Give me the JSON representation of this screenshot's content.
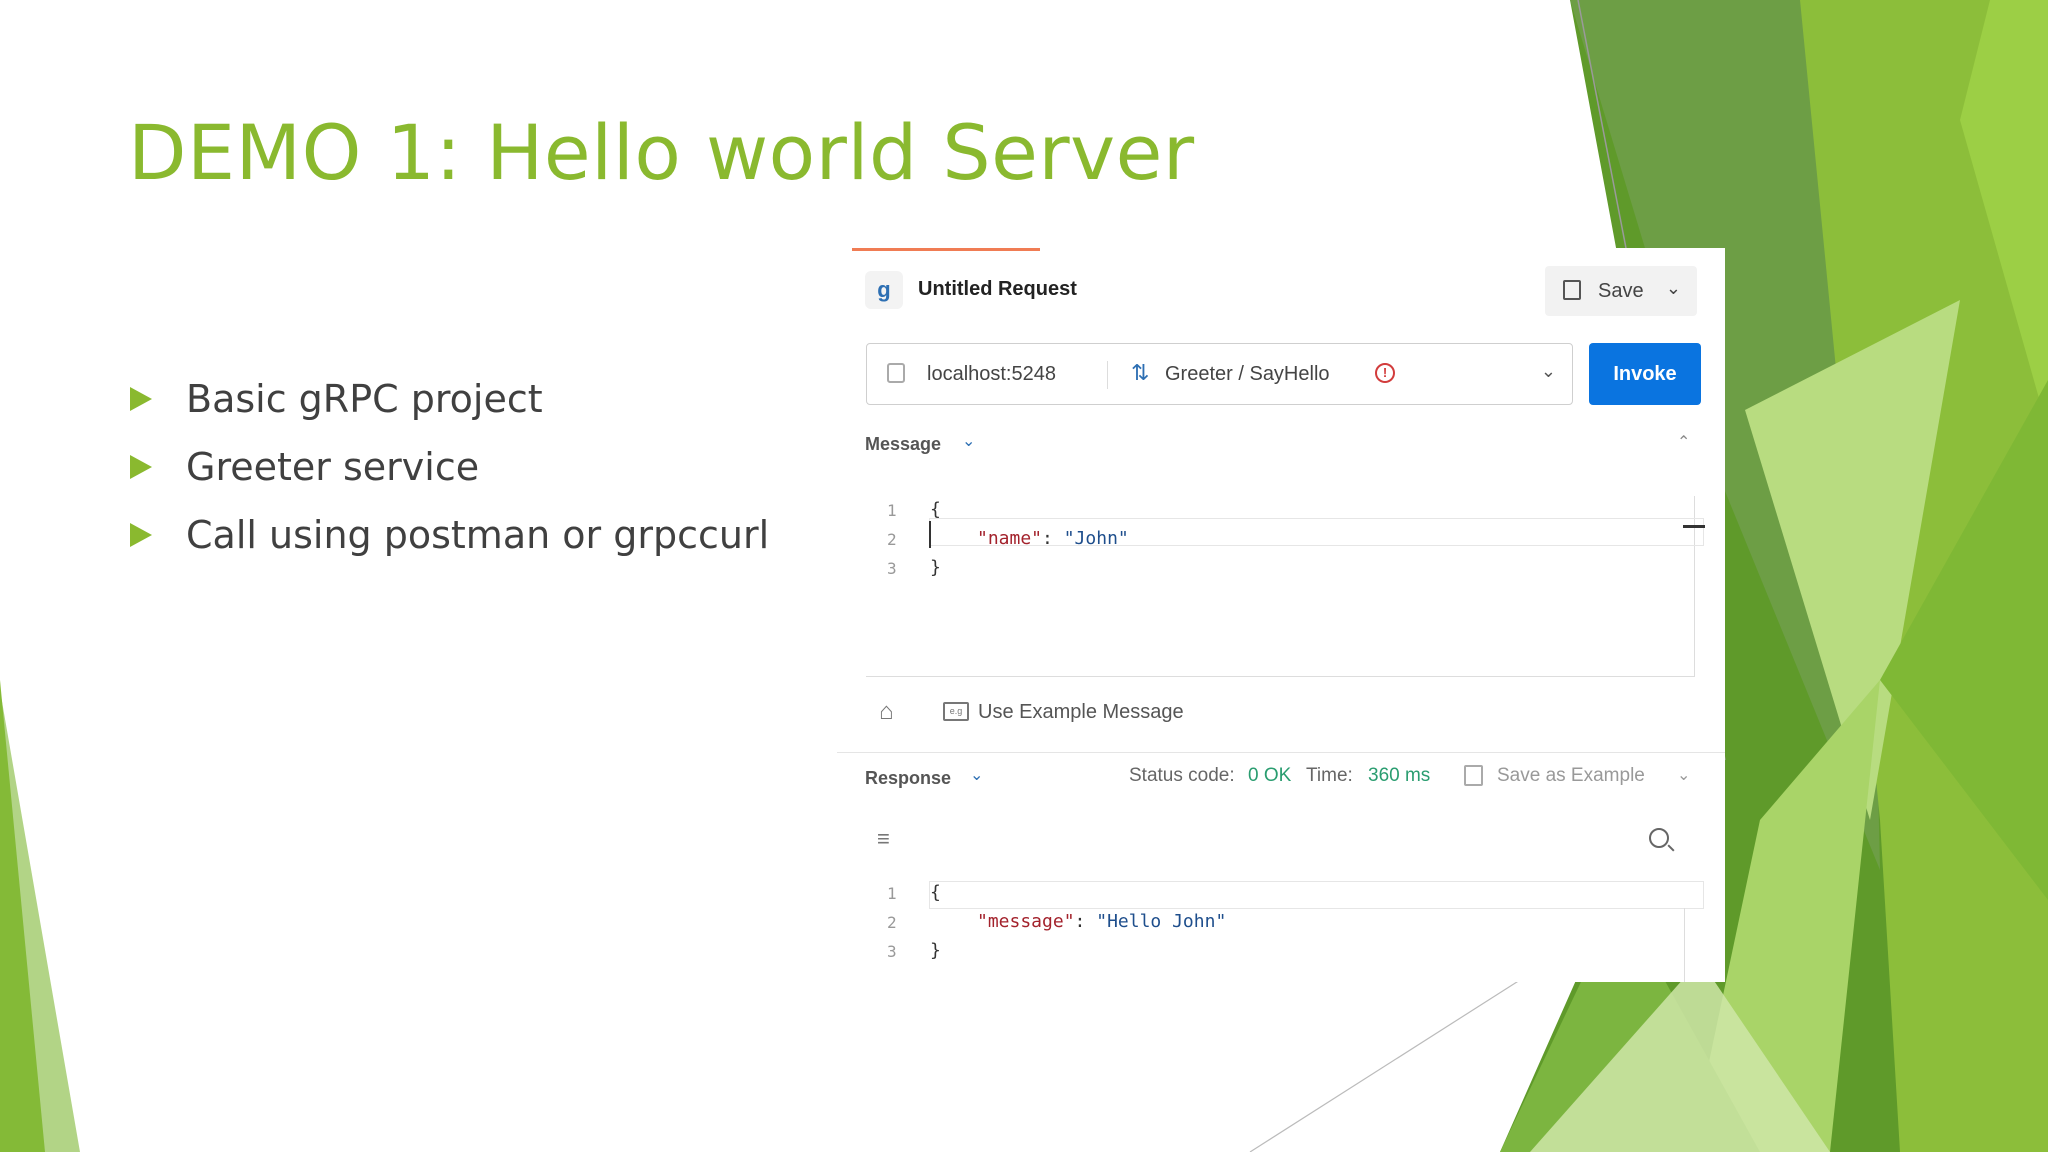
{
  "slide": {
    "title": "DEMO 1: Hello world Server",
    "bullets": [
      "Basic gRPC project",
      "Greeter service",
      "Call using postman or grpccurl"
    ],
    "accent_color": "#8ab92f"
  },
  "postman": {
    "request_icon": "grpc-icon",
    "request_title": "Untitled Request",
    "save_label": "Save",
    "url": "localhost:5248",
    "method": "Greeter / SayHello",
    "invoke_label": "Invoke",
    "message_label": "Message",
    "message_lines": {
      "n1": "1",
      "n2": "2",
      "n3": "3",
      "open": "{",
      "key": "\"name\"",
      "colon": ": ",
      "value": "\"John\"",
      "close": "}"
    },
    "use_example_label": "Use Example Message",
    "response_label": "Response",
    "status_label": "Status code:",
    "status_value": "0 OK",
    "time_label": "Time:",
    "time_value": "360 ms",
    "save_example_label": "Save as Example",
    "response_lines": {
      "n1": "1",
      "n2": "2",
      "n3": "3",
      "open": "{",
      "key": "\"message\"",
      "colon": ": ",
      "value": "\"Hello John\"",
      "close": "}"
    },
    "invoke_color": "#0a74e0",
    "status_color": "#2a9d70"
  }
}
